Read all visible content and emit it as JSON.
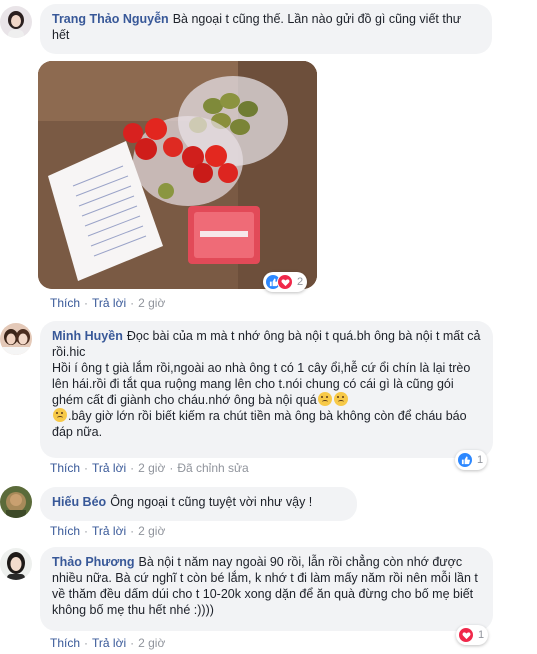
{
  "comments": [
    {
      "author": "Trang Thảo Nguyễn",
      "text": "Bà ngoại t cũng thế. Lần nào gửi đồ gì cũng viết thư hết",
      "actions": {
        "like": "Thích",
        "reply": "Trả lời",
        "time": "2 giờ"
      },
      "reaction_count": "2",
      "reactions": [
        "like-icon",
        "love-icon"
      ]
    },
    {
      "author": "Minh Huyền",
      "text_line1": "Đọc bài của m mà t nhớ ông bà nội t quá.bh ông bà nội t mất cả rồi.hic",
      "text_line2": "Hồi í ông t già lắm rồi,ngoài ao nhà ông t có 1 cây ổi,hễ cứ ổi chín là lại trèo lên hái.rồi đi tắt qua ruộng mang lên cho t.nói chung có cái gì là cũng gói ghém cất đi giành cho cháu.nhớ ông bà nội quá",
      "text_line3": ".bây giờ lớn rồi biết kiếm ra chút tiền mà ông bà không còn để cháu báo đáp nữa.",
      "actions": {
        "like": "Thích",
        "reply": "Trả lời",
        "time": "2 giờ",
        "edited": "Đã chỉnh sửa"
      },
      "reaction_count": "1",
      "reactions": [
        "like-icon"
      ]
    },
    {
      "author": "Hiếu Béo",
      "text": "Ông ngoại t cũng tuyệt vời như vậy !",
      "actions": {
        "like": "Thích",
        "reply": "Trả lời",
        "time": "2 giờ"
      }
    },
    {
      "author": "Thảo Phương",
      "text": "Bà nội t năm nay ngoài 90 rồi, lẫn rồi chẳng còn nhớ được nhiều nữa. Bà cứ nghĩ t còn bé lắm, k nhớ t đi làm mấy năm rồi nên mỗi lần t về thăm đều dấm dúi cho t 10-20k xong dặn để ăn quà đừng cho bố mẹ biết không bố mẹ thu hết nhé :))))",
      "actions": {
        "like": "Thích",
        "reply": "Trả lời",
        "time": "2 giờ"
      },
      "reaction_count": "1",
      "reactions": [
        "love-icon"
      ]
    }
  ],
  "colors": {
    "author": "#385898",
    "bubble": "#f2f3f5",
    "meta": "#90949c",
    "like": "#2d88ff",
    "love": "#f0284a"
  }
}
